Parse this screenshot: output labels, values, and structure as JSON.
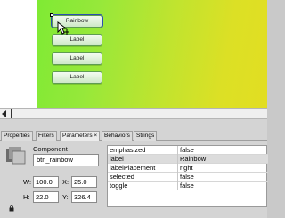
{
  "stage": {
    "buttons": [
      {
        "label": "Rainbow",
        "selected": true
      },
      {
        "label": "Label",
        "selected": false
      },
      {
        "label": "Label",
        "selected": false
      },
      {
        "label": "Label",
        "selected": false
      }
    ],
    "gradient": [
      "#7fea34",
      "#e2de22"
    ]
  },
  "tabs": [
    {
      "label": "Properties",
      "active": false
    },
    {
      "label": "Filters",
      "active": false
    },
    {
      "label": "Parameters ×",
      "active": true
    },
    {
      "label": "Behaviors",
      "active": false
    },
    {
      "label": "Strings",
      "active": false
    }
  ],
  "component": {
    "title": "Component",
    "instance_name": "btn_rainbow",
    "w_label": "W:",
    "w_value": "100.0",
    "x_label": "X:",
    "x_value": "25.0",
    "h_label": "H:",
    "h_value": "22.0",
    "y_label": "Y:",
    "y_value": "326.4"
  },
  "params": [
    {
      "name": "emphasized",
      "value": "false"
    },
    {
      "name": "label",
      "value": "Rainbow"
    },
    {
      "name": "labelPlacement",
      "value": "right"
    },
    {
      "name": "selected",
      "value": "false"
    },
    {
      "name": "toggle",
      "value": "false"
    }
  ],
  "colors": {
    "selection": "#2c4fb0",
    "button_border": "#5e9c52"
  }
}
